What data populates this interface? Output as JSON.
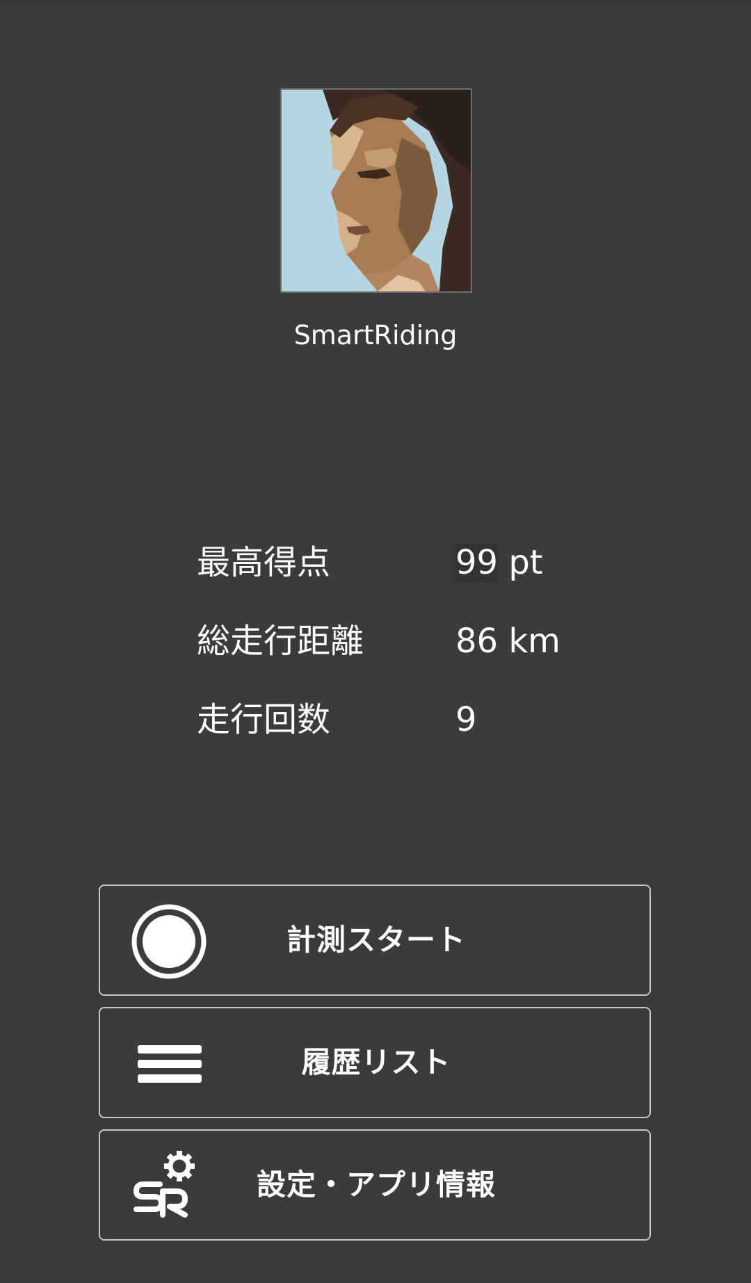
{
  "profile": {
    "username": "SmartRiding"
  },
  "stats": [
    {
      "label": "最高得点",
      "value_num": "99",
      "value_unit": " pt"
    },
    {
      "label": "総走行距離",
      "value_num": "86 km",
      "value_unit": ""
    },
    {
      "label": "走行回数",
      "value_num": "9",
      "value_unit": ""
    }
  ],
  "menu": {
    "start_label": "計測スタート",
    "history_label": "履歴リスト",
    "settings_label": "設定・アプリ情報"
  },
  "icons": {
    "start": "record-circle-icon",
    "history": "hamburger-list-icon",
    "settings": "sr-gear-logo-icon"
  },
  "colors": {
    "background": "#3b3b3d",
    "text": "#ffffff",
    "button_border": "#c9c9c9"
  }
}
